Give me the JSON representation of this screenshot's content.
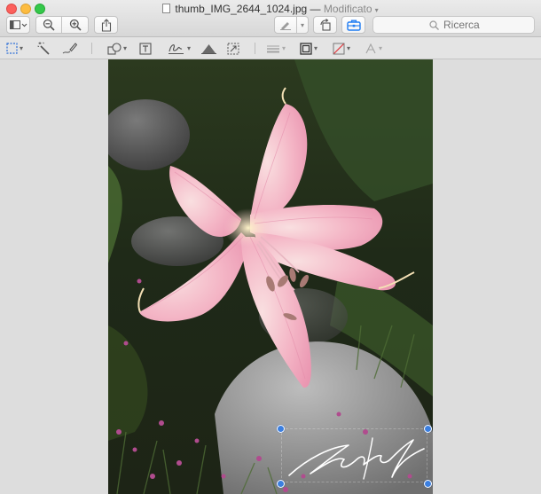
{
  "window": {
    "file_name": "thumb_IMG_2644_1024.jpg",
    "separator": "—",
    "status": "Modificato"
  },
  "toolbar": {
    "search_placeholder": "Ricerca"
  },
  "icons": {
    "sidebar": "sidebar-icon",
    "zoom_out": "zoom-out-icon",
    "zoom_in": "zoom-in-icon",
    "share": "share-icon",
    "markup_pen": "markup-pen-icon",
    "rotate": "rotate-icon",
    "toolbox": "toolbox-icon"
  },
  "colors": {
    "toolbox_accent": "#1f7cf2",
    "selection_handle": "#3b7fe0",
    "close": "#fc605c",
    "minimize": "#fdbc40",
    "maximize": "#34c84a"
  }
}
